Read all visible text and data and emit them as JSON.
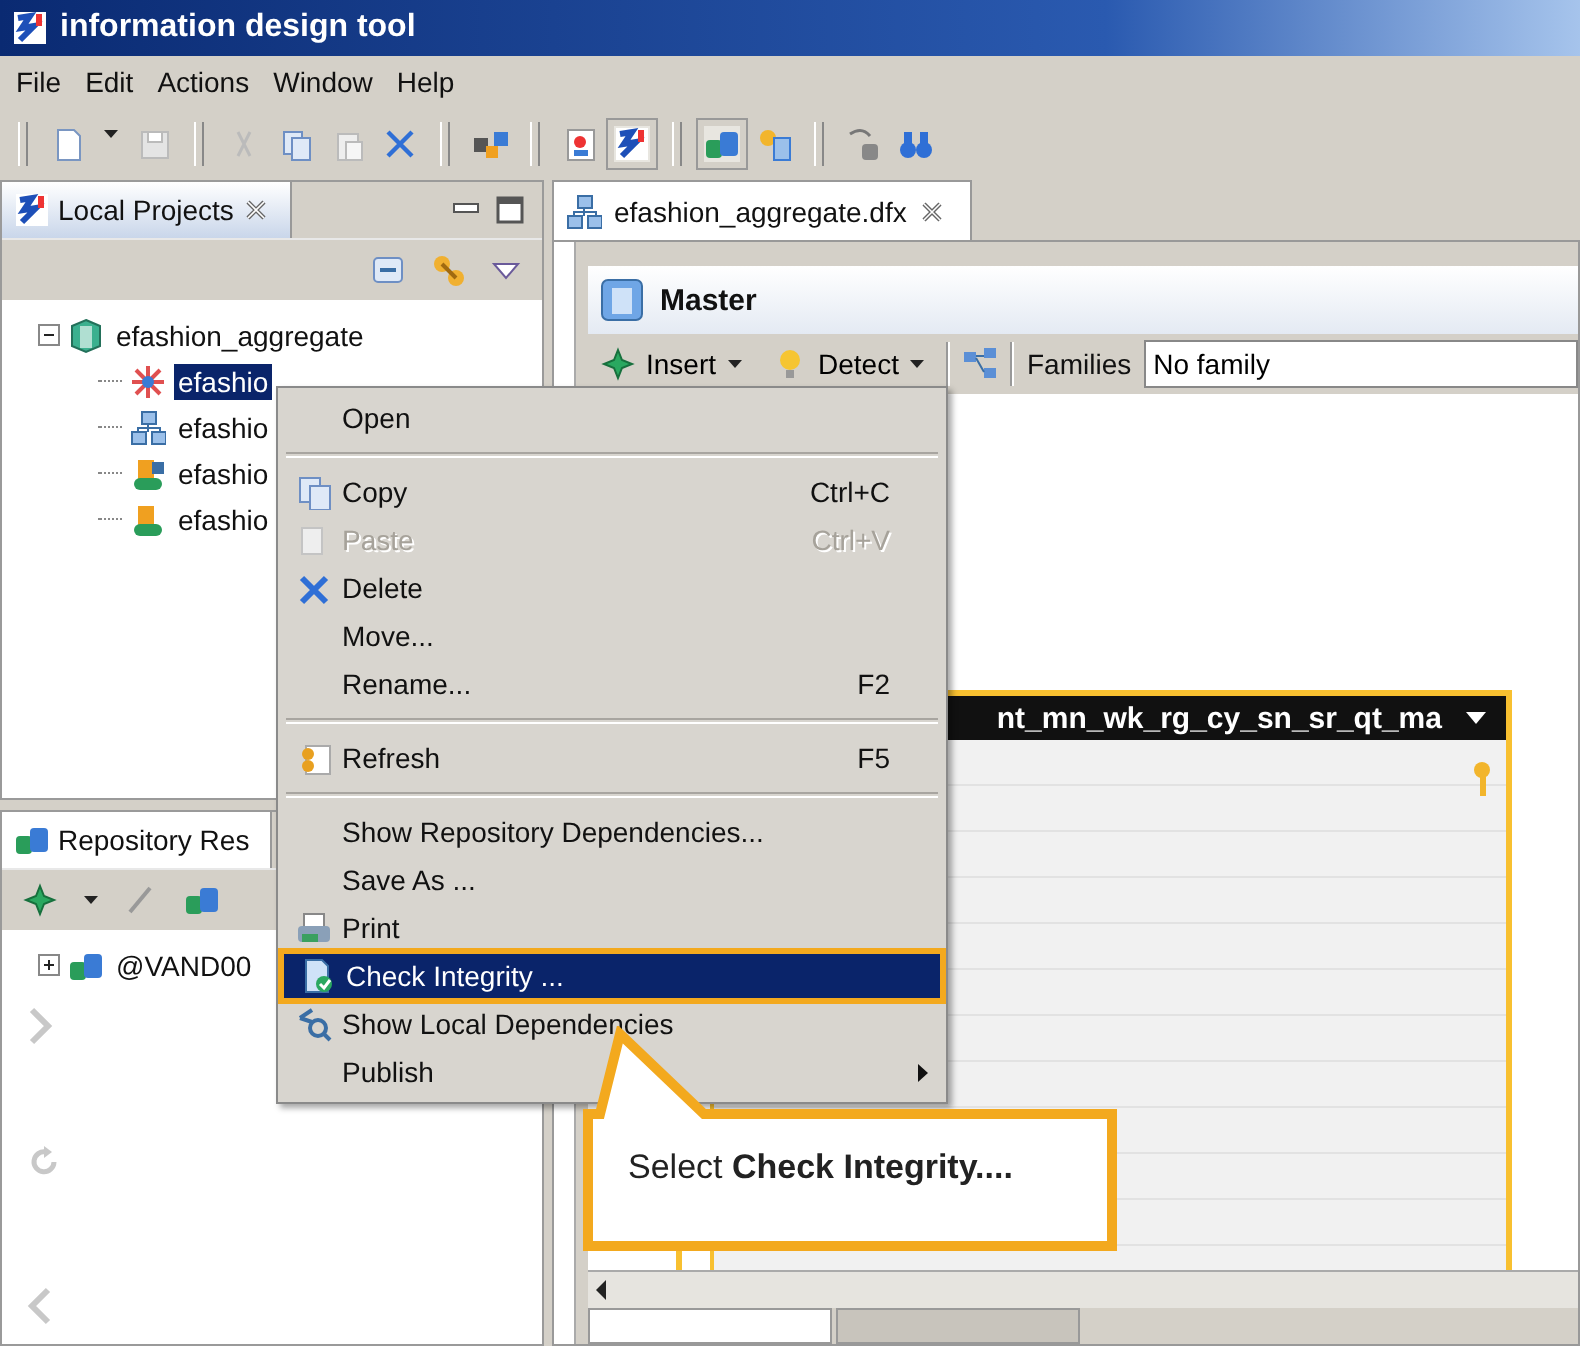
{
  "window": {
    "title": "information design tool"
  },
  "menu_bar": [
    "File",
    "Edit",
    "Actions",
    "Window",
    "Help"
  ],
  "local_projects": {
    "tab": "Local Projects",
    "tree": [
      {
        "label": "efashion_aggregate",
        "expanded": true,
        "selected": false,
        "children": [
          {
            "label": "efashio",
            "selected": true
          },
          {
            "label": "efashio",
            "selected": false
          },
          {
            "label": "efashio",
            "selected": false
          },
          {
            "label": "efashio",
            "selected": false
          }
        ]
      }
    ]
  },
  "repository_resources": {
    "tab": "Repository Res",
    "tree": [
      {
        "label": "@VAND00",
        "expanded": false,
        "selected": false
      }
    ]
  },
  "editor": {
    "tab": "efashion_aggregate.dfx",
    "section": "Master",
    "insert": "Insert",
    "detect": "Detect",
    "families_label": "Families",
    "families_value": "No family",
    "table_header": "nt_mn_wk_rg_cy_sn_sr_qt_ma"
  },
  "context_menu": [
    {
      "kind": "item",
      "label": "Open",
      "disabled": false,
      "selected": false
    },
    {
      "kind": "separator"
    },
    {
      "kind": "item",
      "label": "Copy",
      "shortcut": "Ctrl+C",
      "disabled": false,
      "selected": false
    },
    {
      "kind": "item",
      "label": "Paste",
      "shortcut": "Ctrl+V",
      "disabled": true,
      "selected": false
    },
    {
      "kind": "item",
      "label": "Delete",
      "disabled": false,
      "selected": false
    },
    {
      "kind": "item",
      "label": "Move...",
      "disabled": false,
      "selected": false
    },
    {
      "kind": "item",
      "label": "Rename...",
      "shortcut": "F2",
      "disabled": false,
      "selected": false
    },
    {
      "kind": "separator"
    },
    {
      "kind": "item",
      "label": "Refresh",
      "shortcut": "F5",
      "disabled": false,
      "selected": false
    },
    {
      "kind": "separator"
    },
    {
      "kind": "item",
      "label": "Show Repository Dependencies...",
      "disabled": false,
      "selected": false
    },
    {
      "kind": "item",
      "label": "Save As ...",
      "disabled": false,
      "selected": false
    },
    {
      "kind": "item",
      "label": "Print",
      "disabled": false,
      "selected": false
    },
    {
      "kind": "item",
      "label": "Check Integrity ...",
      "disabled": false,
      "selected": true
    },
    {
      "kind": "item",
      "label": "Show Local Dependencies",
      "disabled": false,
      "selected": false
    },
    {
      "kind": "item",
      "label": "Publish",
      "submenu": true,
      "disabled": false,
      "selected": false
    }
  ],
  "callout": "Select **Check Integrity....**"
}
